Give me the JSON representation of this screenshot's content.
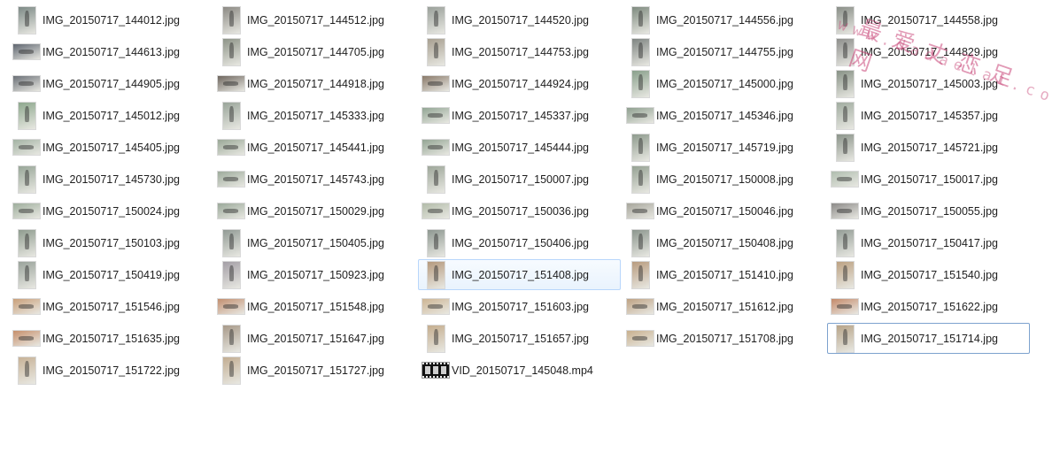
{
  "files": [
    {
      "name": "IMG_20150717_144012.jpg",
      "thumb": "portrait",
      "tone": "#7d8a86"
    },
    {
      "name": "IMG_20150717_144512.jpg",
      "thumb": "portrait",
      "tone": "#8c8a84"
    },
    {
      "name": "IMG_20150717_144520.jpg",
      "thumb": "portrait",
      "tone": "#9aa09a"
    },
    {
      "name": "IMG_20150717_144556.jpg",
      "thumb": "portrait",
      "tone": "#7f8b80"
    },
    {
      "name": "IMG_20150717_144558.jpg",
      "thumb": "portrait",
      "tone": "#8a8f88"
    },
    {
      "name": "IMG_20150717_144613.jpg",
      "thumb": "landscape",
      "tone": "#5f6670"
    },
    {
      "name": "IMG_20150717_144705.jpg",
      "thumb": "portrait",
      "tone": "#8e9488"
    },
    {
      "name": "IMG_20150717_144753.jpg",
      "thumb": "portrait",
      "tone": "#a79f90"
    },
    {
      "name": "IMG_20150717_144755.jpg",
      "thumb": "portrait",
      "tone": "#7f8582"
    },
    {
      "name": "IMG_20150717_144829.jpg",
      "thumb": "portrait",
      "tone": "#8e8f8c"
    },
    {
      "name": "IMG_20150717_144905.jpg",
      "thumb": "landscape",
      "tone": "#6b7077"
    },
    {
      "name": "IMG_20150717_144918.jpg",
      "thumb": "landscape",
      "tone": "#6e665e"
    },
    {
      "name": "IMG_20150717_144924.jpg",
      "thumb": "landscape",
      "tone": "#8a7a6a"
    },
    {
      "name": "IMG_20150717_145000.jpg",
      "thumb": "portrait",
      "tone": "#8aa08c"
    },
    {
      "name": "IMG_20150717_145003.jpg",
      "thumb": "portrait",
      "tone": "#889286"
    },
    {
      "name": "IMG_20150717_145012.jpg",
      "thumb": "portrait",
      "tone": "#8ea88e"
    },
    {
      "name": "IMG_20150717_145333.jpg",
      "thumb": "portrait",
      "tone": "#9aa59a"
    },
    {
      "name": "IMG_20150717_145337.jpg",
      "thumb": "landscape",
      "tone": "#93a695"
    },
    {
      "name": "IMG_20150717_145346.jpg",
      "thumb": "landscape",
      "tone": "#8fa090"
    },
    {
      "name": "IMG_20150717_145357.jpg",
      "thumb": "portrait",
      "tone": "#a1aca0"
    },
    {
      "name": "IMG_20150717_145405.jpg",
      "thumb": "landscape",
      "tone": "#a4b3a4"
    },
    {
      "name": "IMG_20150717_145441.jpg",
      "thumb": "landscape",
      "tone": "#9aa897"
    },
    {
      "name": "IMG_20150717_145444.jpg",
      "thumb": "landscape",
      "tone": "#94a594"
    },
    {
      "name": "IMG_20150717_145719.jpg",
      "thumb": "portrait",
      "tone": "#8f9b8e"
    },
    {
      "name": "IMG_20150717_145721.jpg",
      "thumb": "portrait",
      "tone": "#8b948a"
    },
    {
      "name": "IMG_20150717_145730.jpg",
      "thumb": "portrait",
      "tone": "#98a698"
    },
    {
      "name": "IMG_20150717_145743.jpg",
      "thumb": "landscape",
      "tone": "#9eab9c"
    },
    {
      "name": "IMG_20150717_150007.jpg",
      "thumb": "portrait",
      "tone": "#9ea79a"
    },
    {
      "name": "IMG_20150717_150008.jpg",
      "thumb": "portrait",
      "tone": "#96a294"
    },
    {
      "name": "IMG_20150717_150017.jpg",
      "thumb": "landscape",
      "tone": "#b0bdaf"
    },
    {
      "name": "IMG_20150717_150024.jpg",
      "thumb": "landscape",
      "tone": "#9fae9d"
    },
    {
      "name": "IMG_20150717_150029.jpg",
      "thumb": "landscape",
      "tone": "#9ba99a"
    },
    {
      "name": "IMG_20150717_150036.jpg",
      "thumb": "landscape",
      "tone": "#b2bba9"
    },
    {
      "name": "IMG_20150717_150046.jpg",
      "thumb": "landscape",
      "tone": "#a7a69c"
    },
    {
      "name": "IMG_20150717_150055.jpg",
      "thumb": "landscape",
      "tone": "#8c8a88"
    },
    {
      "name": "IMG_20150717_150103.jpg",
      "thumb": "portrait",
      "tone": "#8f9c8f"
    },
    {
      "name": "IMG_20150717_150405.jpg",
      "thumb": "portrait",
      "tone": "#929b95"
    },
    {
      "name": "IMG_20150717_150406.jpg",
      "thumb": "portrait",
      "tone": "#8e9891"
    },
    {
      "name": "IMG_20150717_150408.jpg",
      "thumb": "portrait",
      "tone": "#8c968e"
    },
    {
      "name": "IMG_20150717_150417.jpg",
      "thumb": "portrait",
      "tone": "#949d96"
    },
    {
      "name": "IMG_20150717_150419.jpg",
      "thumb": "portrait",
      "tone": "#9aa39b"
    },
    {
      "name": "IMG_20150717_150923.jpg",
      "thumb": "portrait",
      "tone": "#a49fa6"
    },
    {
      "name": "IMG_20150717_151408.jpg",
      "thumb": "portrait",
      "tone": "#b59a7e",
      "state": "selected"
    },
    {
      "name": "IMG_20150717_151410.jpg",
      "thumb": "portrait",
      "tone": "#b89c7f"
    },
    {
      "name": "IMG_20150717_151540.jpg",
      "thumb": "portrait",
      "tone": "#bca283"
    },
    {
      "name": "IMG_20150717_151546.jpg",
      "thumb": "landscape",
      "tone": "#c9a07a"
    },
    {
      "name": "IMG_20150717_151548.jpg",
      "thumb": "landscape",
      "tone": "#c28f70"
    },
    {
      "name": "IMG_20150717_151603.jpg",
      "thumb": "landscape",
      "tone": "#cdb594"
    },
    {
      "name": "IMG_20150717_151612.jpg",
      "thumb": "landscape",
      "tone": "#bea283"
    },
    {
      "name": "IMG_20150717_151622.jpg",
      "thumb": "landscape",
      "tone": "#c48a6a"
    },
    {
      "name": "IMG_20150717_151635.jpg",
      "thumb": "landscape",
      "tone": "#c6906c"
    },
    {
      "name": "IMG_20150717_151647.jpg",
      "thumb": "portrait",
      "tone": "#a89a8a"
    },
    {
      "name": "IMG_20150717_151657.jpg",
      "thumb": "portrait",
      "tone": "#c4ad8e"
    },
    {
      "name": "IMG_20150717_151708.jpg",
      "thumb": "landscape",
      "tone": "#c8b08e"
    },
    {
      "name": "IMG_20150717_151714.jpg",
      "thumb": "portrait",
      "tone": "#b7a489",
      "state": "focused"
    },
    {
      "name": "IMG_20150717_151722.jpg",
      "thumb": "portrait",
      "tone": "#c7b297"
    },
    {
      "name": "IMG_20150717_151727.jpg",
      "thumb": "portrait",
      "tone": "#c2ad92"
    },
    {
      "name": "VID_20150717_145048.mp4",
      "thumb": "video",
      "tone": "#111111"
    }
  ],
  "watermark": {
    "line1": "最爱丈恋足网",
    "line2": "www.dadaelai.com"
  },
  "colors": {
    "selected_border": "#b8d6fb",
    "focused_border": "#7da2ce"
  }
}
